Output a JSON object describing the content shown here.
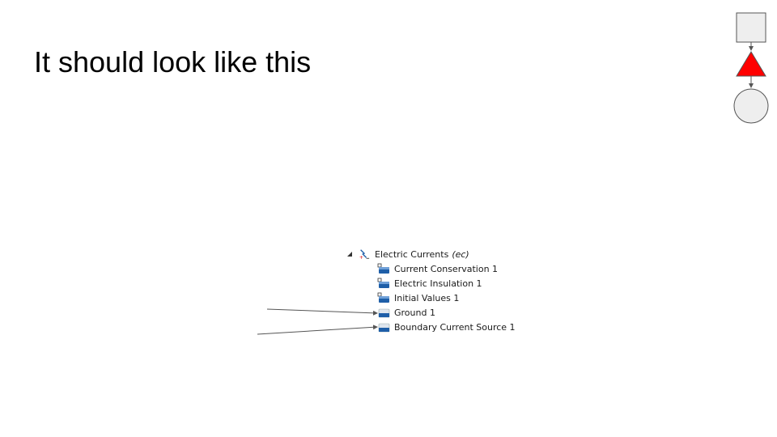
{
  "slide": {
    "title": "It should look like this"
  },
  "shapes": [
    {
      "kind": "square",
      "fill": "#eeeeee",
      "stroke": "#555555",
      "icon": "square-shape"
    },
    {
      "kind": "triangle",
      "fill": "#ff0000",
      "stroke": "#555555",
      "icon": "triangle-shape"
    },
    {
      "kind": "circle",
      "fill": "#eeeeee",
      "stroke": "#555555",
      "icon": "circle-shape"
    }
  ],
  "tree": {
    "parent": {
      "label": "Electric Currents",
      "suffix": "(ec)",
      "icon": "electric-currents-icon",
      "expanded": true
    },
    "children": [
      {
        "label": "Current Conservation 1",
        "icon": "domain-feature-icon"
      },
      {
        "label": "Electric Insulation 1",
        "icon": "domain-feature-icon"
      },
      {
        "label": "Initial Values 1",
        "icon": "domain-feature-icon"
      },
      {
        "label": "Ground 1",
        "icon": "boundary-feature-icon"
      },
      {
        "label": "Boundary Current Source 1",
        "icon": "boundary-feature-icon"
      }
    ]
  },
  "colors": {
    "icon_blue": "#1f5fa8",
    "arrow": "#555555"
  }
}
